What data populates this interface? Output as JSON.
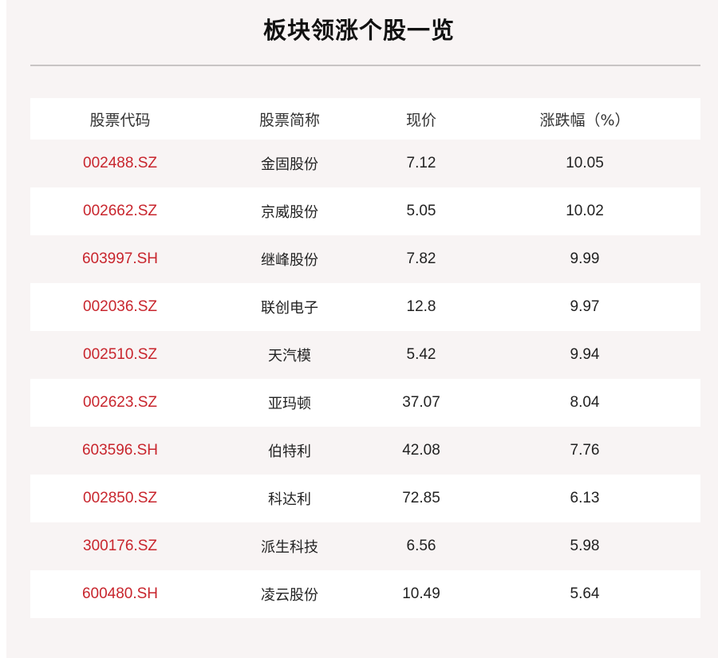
{
  "title": "板块领涨个股一览",
  "colors": {
    "code_red": "#c8252d",
    "panel_bg": "#f8f4f4"
  },
  "table": {
    "headers": [
      "股票代码",
      "股票简称",
      "现价",
      "涨跌幅（%）"
    ],
    "rows": [
      {
        "code": "002488.SZ",
        "name": "金固股份",
        "price": "7.12",
        "change": "10.05"
      },
      {
        "code": "002662.SZ",
        "name": "京威股份",
        "price": "5.05",
        "change": "10.02"
      },
      {
        "code": "603997.SH",
        "name": "继峰股份",
        "price": "7.82",
        "change": "9.99"
      },
      {
        "code": "002036.SZ",
        "name": "联创电子",
        "price": "12.8",
        "change": "9.97"
      },
      {
        "code": "002510.SZ",
        "name": "天汽模",
        "price": "5.42",
        "change": "9.94"
      },
      {
        "code": "002623.SZ",
        "name": "亚玛顿",
        "price": "37.07",
        "change": "8.04"
      },
      {
        "code": "603596.SH",
        "name": "伯特利",
        "price": "42.08",
        "change": "7.76"
      },
      {
        "code": "002850.SZ",
        "name": "科达利",
        "price": "72.85",
        "change": "6.13"
      },
      {
        "code": "300176.SZ",
        "name": "派生科技",
        "price": "6.56",
        "change": "5.98"
      },
      {
        "code": "600480.SH",
        "name": "凌云股份",
        "price": "10.49",
        "change": "5.64"
      }
    ]
  }
}
